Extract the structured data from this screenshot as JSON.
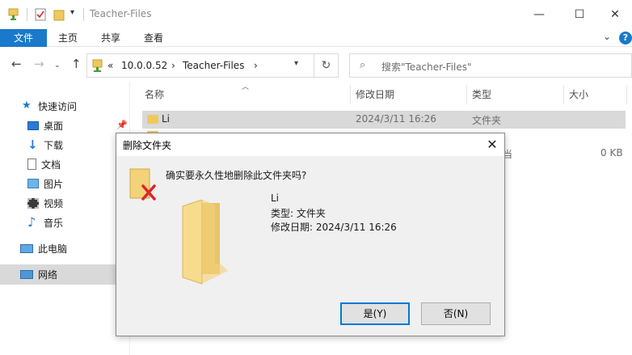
{
  "window": {
    "title": "Teacher-Files",
    "minimize": "—",
    "maximize": "☐",
    "close": "✕"
  },
  "ribbon": {
    "tabs": [
      "文件",
      "主页",
      "共享",
      "查看"
    ],
    "expand_icon": "⌄",
    "help_icon": "?"
  },
  "address": {
    "chevron": "«",
    "segments": [
      "10.0.0.52",
      "Teacher-Files"
    ],
    "separator": "›",
    "refresh_icon": "↻"
  },
  "search": {
    "placeholder": "搜索\"Teacher-Files\""
  },
  "nav": {
    "items": [
      {
        "label": "快速访问",
        "icon": "star-icon"
      },
      {
        "label": "桌面",
        "icon": "desktop-icon"
      },
      {
        "label": "下载",
        "icon": "download-icon"
      },
      {
        "label": "文档",
        "icon": "document-icon"
      },
      {
        "label": "图片",
        "icon": "pictures-icon"
      },
      {
        "label": "视频",
        "icon": "video-icon"
      },
      {
        "label": "音乐",
        "icon": "music-icon"
      },
      {
        "label": "此电脑",
        "icon": "computer-icon"
      },
      {
        "label": "网络",
        "icon": "network-icon"
      }
    ]
  },
  "columns": {
    "name": "名称",
    "modified": "修改日期",
    "type": "类型",
    "size": "大小"
  },
  "files": [
    {
      "name": "Li",
      "modified": "2024/3/11 16:26",
      "type": "文件夹",
      "size": ""
    },
    {
      "name": "",
      "modified": "",
      "type": "当",
      "size": "0 KB"
    }
  ],
  "dialog": {
    "title": "删除文件夹",
    "close": "✕",
    "question": "确实要永久性地删除此文件夹吗?",
    "item_name": "Li",
    "item_type": "类型: 文件夹",
    "item_modified": "修改日期: 2024/3/11 16:26",
    "yes_label": "是(Y)",
    "no_label": "否(N)"
  },
  "colors": {
    "accent": "#1979ca",
    "folder": "#f1c860",
    "delete_x": "#d9262c",
    "selection": "#d9d9d9"
  }
}
